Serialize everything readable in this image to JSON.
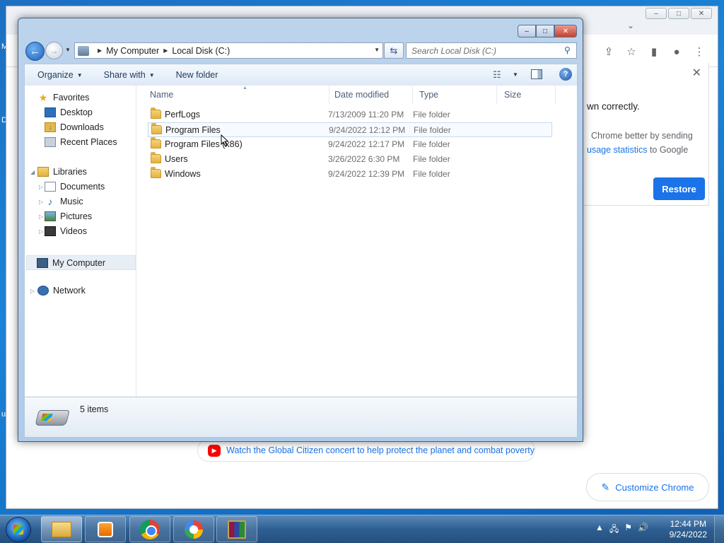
{
  "desktop": {
    "glyphs": [
      "M",
      "D",
      "u"
    ]
  },
  "chrome": {
    "caption_buttons": [
      "–",
      "□",
      "✕"
    ],
    "restore_card": {
      "line1": "wn correctly.",
      "line2": "Chrome better by sending",
      "line3_link": "usage statistics",
      "line3_rest": " to Google",
      "button": "Restore"
    },
    "promo_text": "Watch the Global Citizen concert to help protect the planet and combat poverty",
    "customize_label": "Customize Chrome"
  },
  "explorer": {
    "caption_buttons": {
      "minimize": "–",
      "maximize": "□",
      "close": "✕"
    },
    "address": {
      "computer": "My Computer",
      "drive": "Local Disk (C:)"
    },
    "search": {
      "placeholder": "Search Local Disk (C:)"
    },
    "commands": {
      "organize": "Organize",
      "share_with": "Share with",
      "new_folder": "New folder"
    },
    "nav": {
      "favorites": "Favorites",
      "desktop": "Desktop",
      "downloads": "Downloads",
      "recent_places": "Recent Places",
      "libraries": "Libraries",
      "documents": "Documents",
      "music": "Music",
      "pictures": "Pictures",
      "videos": "Videos",
      "my_computer": "My Computer",
      "network": "Network"
    },
    "columns": {
      "name": "Name",
      "date": "Date modified",
      "type": "Type",
      "size": "Size"
    },
    "files": [
      {
        "name": "PerfLogs",
        "date": "7/13/2009 11:20 PM",
        "type": "File folder"
      },
      {
        "name": "Program Files",
        "date": "9/24/2022 12:12 PM",
        "type": "File folder"
      },
      {
        "name": "Program Files (x86)",
        "date": "9/24/2022 12:17 PM",
        "type": "File folder"
      },
      {
        "name": "Users",
        "date": "3/26/2022 6:30 PM",
        "type": "File folder"
      },
      {
        "name": "Windows",
        "date": "9/24/2022 12:39 PM",
        "type": "File folder"
      }
    ],
    "status": {
      "items": "5 items"
    }
  },
  "taskbar": {
    "apps": [
      "Windows Explorer",
      "Windows Media Player",
      "Google Chrome",
      "Google Lens",
      "WinRAR"
    ],
    "clock": {
      "time": "12:44 PM",
      "date": "9/24/2022"
    }
  }
}
